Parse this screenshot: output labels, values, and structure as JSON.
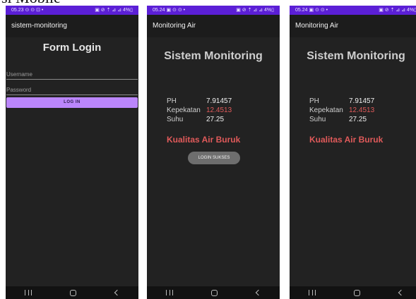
{
  "page_heading": "si Mobile",
  "phones": [
    {
      "status": {
        "time": "05.23 ⊙ ⊙ ⊡ •",
        "indicators": "▣ ⊘ ⇡ ⊿ ⊿ 4%▯"
      },
      "app_title": "sistem-monitoring",
      "form_title": "Form Login",
      "username_placeholder": "Username",
      "password_placeholder": "Password",
      "login_label": "LOG IN"
    },
    {
      "status": {
        "time": "05.24 ▣ ⊙ ⊙ •",
        "indicators": "▣ ⊘ ⇡ ⊿ ⊿ 4%▯"
      },
      "app_title": "Monitoring Air",
      "title": "Sistem Monitoring",
      "ph_label": "PH",
      "ph_value": "7.91457",
      "turbidity_label": "Kepekatan",
      "turbidity_value": "12.4513",
      "temp_label": "Suhu",
      "temp_value": "27.25",
      "quality": "Kualitas Air Buruk",
      "toast": "LOGIN SUKSES"
    },
    {
      "status": {
        "time": "05.24 ▣ ⊙ ⊙ •",
        "indicators": "▣ ⊘ ⇡ ⊿ ⊿ 4%▯"
      },
      "app_title": "Monitoring Air",
      "title": "Sistem Monitoring",
      "ph_label": "PH",
      "ph_value": "7.91457",
      "turbidity_label": "Kepekatan",
      "turbidity_value": "12.4513",
      "temp_label": "Suhu",
      "temp_value": "27.25",
      "quality": "Kualitas Air Buruk"
    }
  ],
  "colors": {
    "status_bar": "#5b1fd6",
    "button": "#bb86fc",
    "warning_text": "#e05a5a",
    "background": "#222222"
  },
  "icons": [
    "nav-recents-icon",
    "nav-home-icon",
    "nav-back-icon"
  ]
}
